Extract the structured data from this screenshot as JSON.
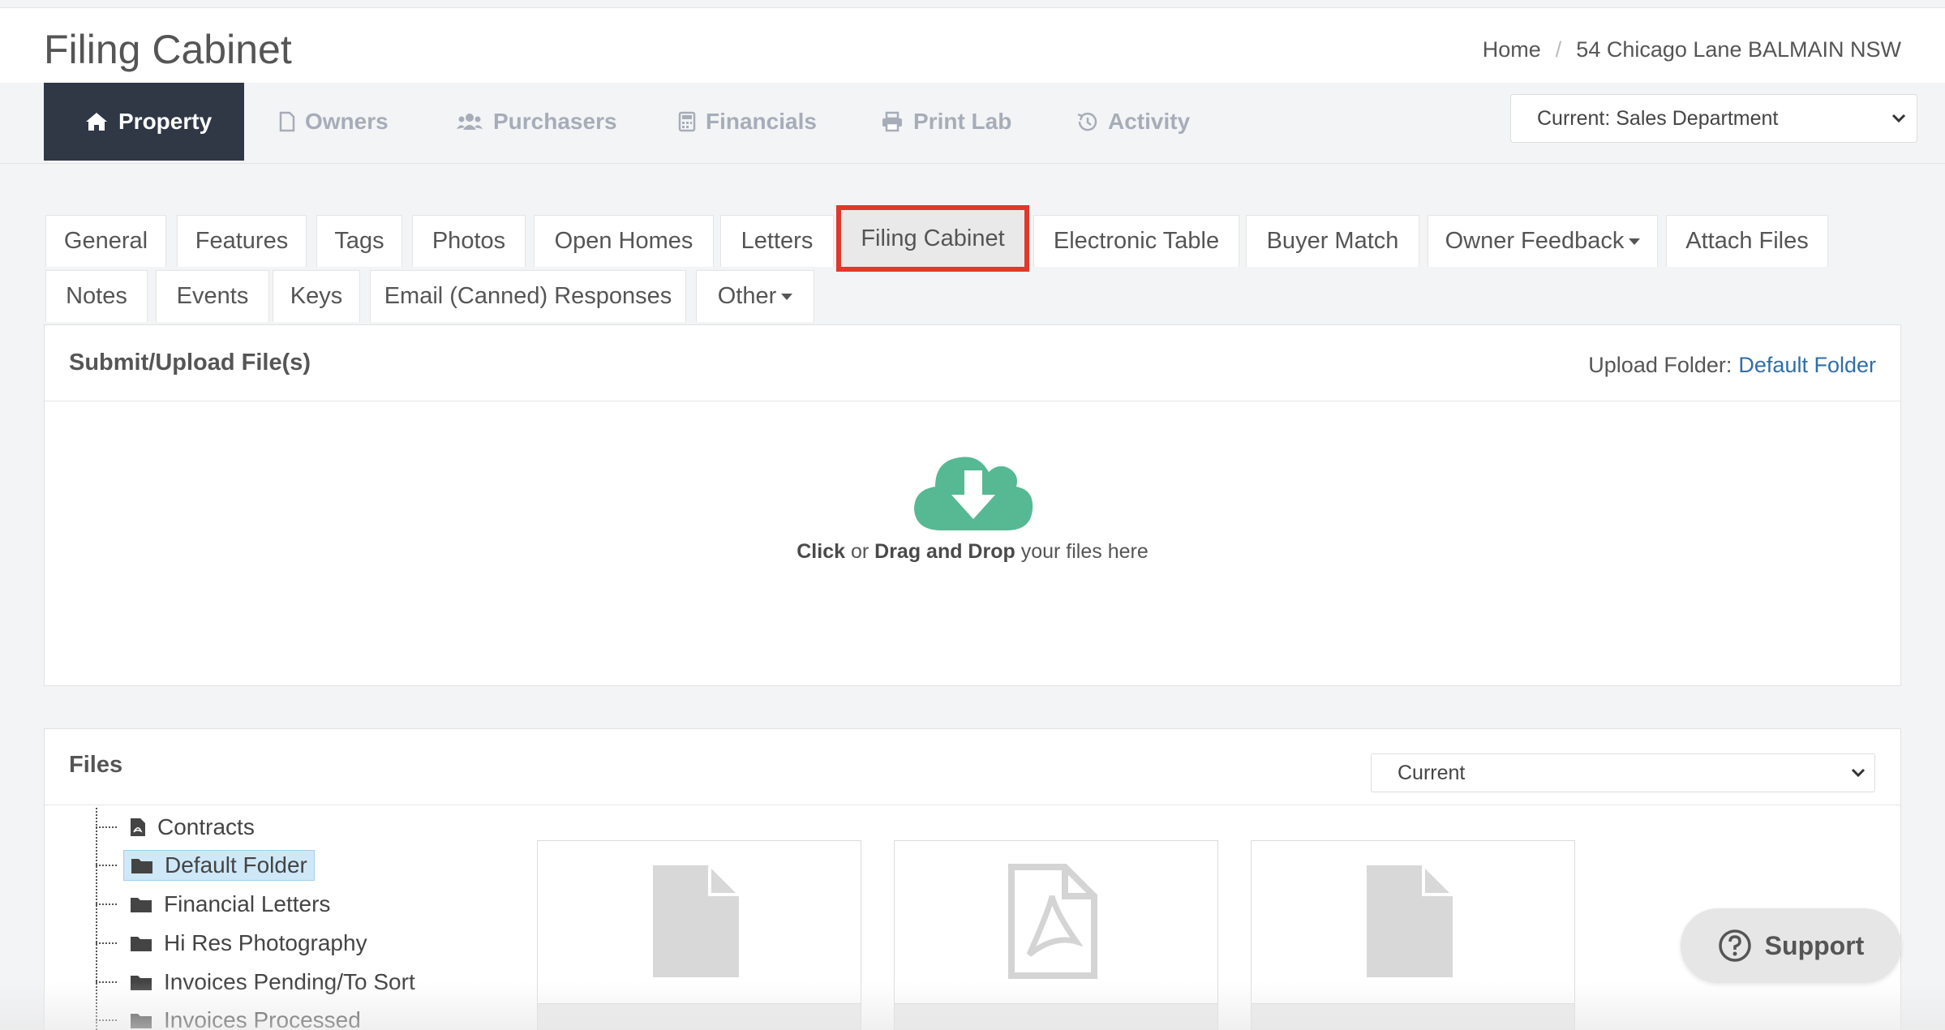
{
  "header": {
    "title": "Filing Cabinet",
    "breadcrumb": {
      "home": "Home",
      "separator": "/",
      "current": "54 Chicago Lane BALMAIN NSW"
    }
  },
  "nav": {
    "items": [
      {
        "label": "Property",
        "icon": "home-icon"
      },
      {
        "label": "Owners",
        "icon": "document-icon"
      },
      {
        "label": "Purchasers",
        "icon": "users-icon"
      },
      {
        "label": "Financials",
        "icon": "calculator-icon"
      },
      {
        "label": "Print Lab",
        "icon": "printer-icon"
      },
      {
        "label": "Activity",
        "icon": "history-icon"
      }
    ],
    "department_select": "Current: Sales Department"
  },
  "tabs": {
    "row1": [
      "General",
      "Features",
      "Tags",
      "Photos",
      "Open Homes",
      "Letters",
      "Filing Cabinet",
      "Electronic Table",
      "Buyer Match",
      "Owner Feedback",
      "Attach Files"
    ],
    "row2": [
      "Notes",
      "Events",
      "Keys",
      "Email (Canned) Responses",
      "Other"
    ],
    "active": "Filing Cabinet"
  },
  "upload": {
    "title": "Submit/Upload File(s)",
    "folder_label": "Upload Folder:",
    "folder_link": "Default Folder",
    "drop_click": "Click",
    "drop_or": " or ",
    "drop_drag": "Drag and Drop",
    "drop_rest": " your files here",
    "accent": "#57b894"
  },
  "files": {
    "title": "Files",
    "filter_select": "Current",
    "tree": [
      {
        "label": "Contracts",
        "icon": "pdf-file-icon"
      },
      {
        "label": "Default Folder",
        "icon": "folder-icon",
        "selected": true
      },
      {
        "label": "Financial Letters",
        "icon": "folder-icon"
      },
      {
        "label": "Hi Res Photography",
        "icon": "folder-icon"
      },
      {
        "label": "Invoices Pending/To Sort",
        "icon": "folder-icon"
      },
      {
        "label": "Invoices Processed",
        "icon": "folder-icon"
      }
    ],
    "cards": [
      {
        "icon": "file-icon"
      },
      {
        "icon": "pdf-file-icon"
      },
      {
        "icon": "file-icon"
      }
    ]
  },
  "support": {
    "label": "Support"
  },
  "colors": {
    "nav_active": "#303846",
    "link": "#2f6ea8",
    "highlight": "#e0392b",
    "selected_tree": "#cfe8f8"
  }
}
